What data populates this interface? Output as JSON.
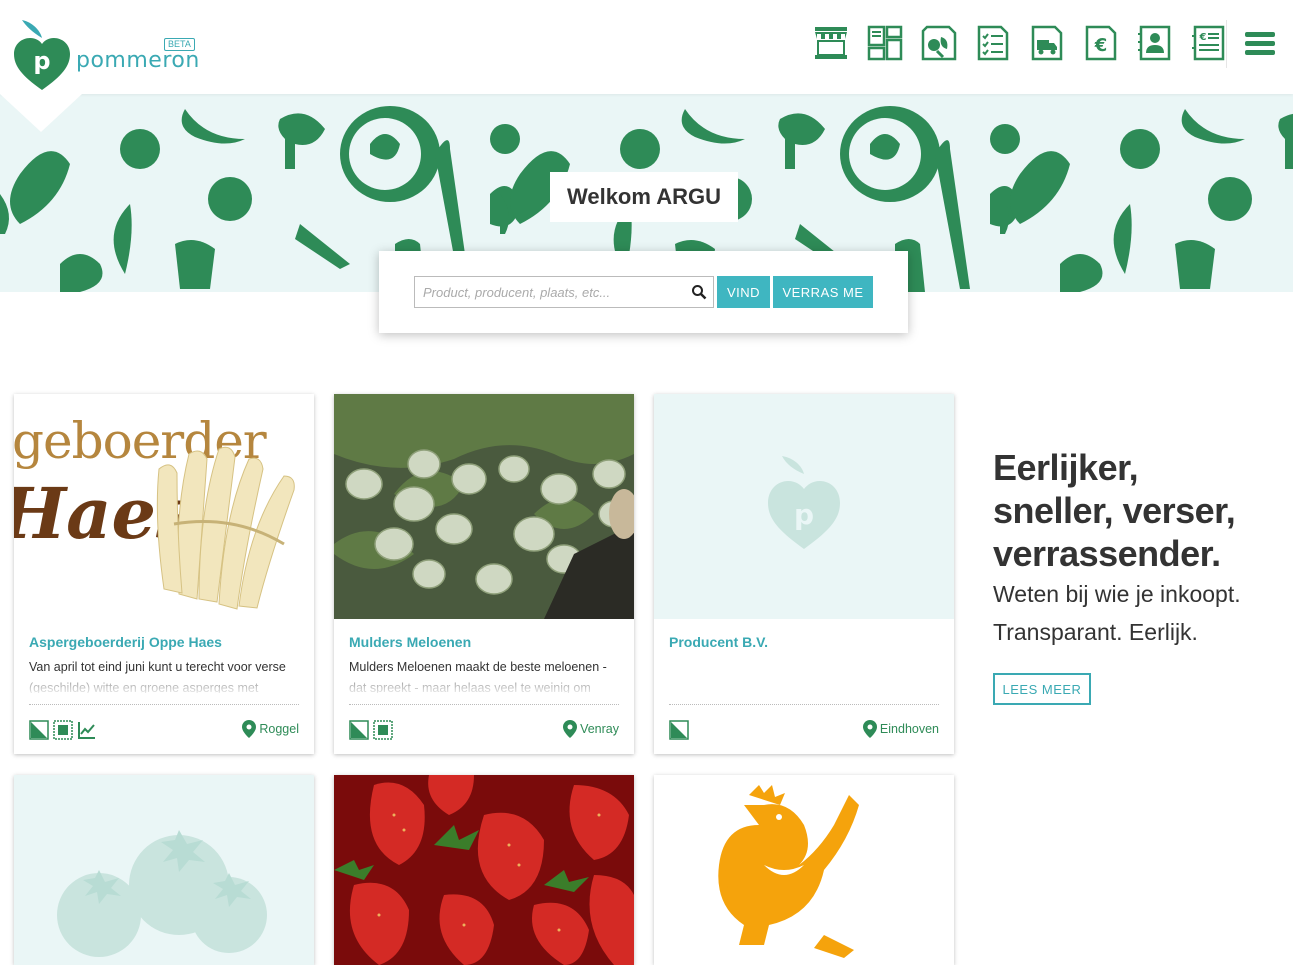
{
  "app": {
    "logo_text": "pommeron",
    "beta_badge": "BETA",
    "logo_letter": "p"
  },
  "nav": {
    "icons": [
      "market-stall-icon",
      "dashboard-grid-icon",
      "products-icon",
      "checklist-icon",
      "delivery-truck-icon",
      "euro-icon",
      "contact-book-icon",
      "invoice-icon"
    ],
    "menu": "hamburger-menu-icon"
  },
  "hero": {
    "welcome": "Welkom ARGU",
    "search": {
      "placeholder": "Product, producent, plaats, etc...",
      "find_label": "VIND",
      "surprise_label": "VERRAS ME"
    }
  },
  "cards": [
    {
      "title": "Aspergeboerderij Oppe Haes",
      "description": "Van april tot eind juni kunt u terecht voor verse (geschilde) witte en groene asperges met",
      "location": "Roggel",
      "image_text_1": "geboerder",
      "image_text_2": "Haes"
    },
    {
      "title": "Mulders Meloenen",
      "description": "Mulders Meloenen maakt de beste meloenen - dat spreekt - maar helaas veel te weinig om",
      "location": "Venray"
    },
    {
      "title": "Producent B.V.",
      "description": "",
      "location": "Eindhoven"
    }
  ],
  "promo": {
    "tagline": [
      "Eerlijker,",
      "sneller, verser,",
      "verrassender."
    ],
    "sub": [
      "Weten bij wie je inkoopt.",
      "Transparant. Eerlijk."
    ],
    "button": "LEES MEER"
  },
  "colors": {
    "brand_green": "#2e8b57",
    "brand_teal": "#3aa9b3",
    "button_teal": "#3fb6c1",
    "hero_bg": "#eaf6f6"
  }
}
